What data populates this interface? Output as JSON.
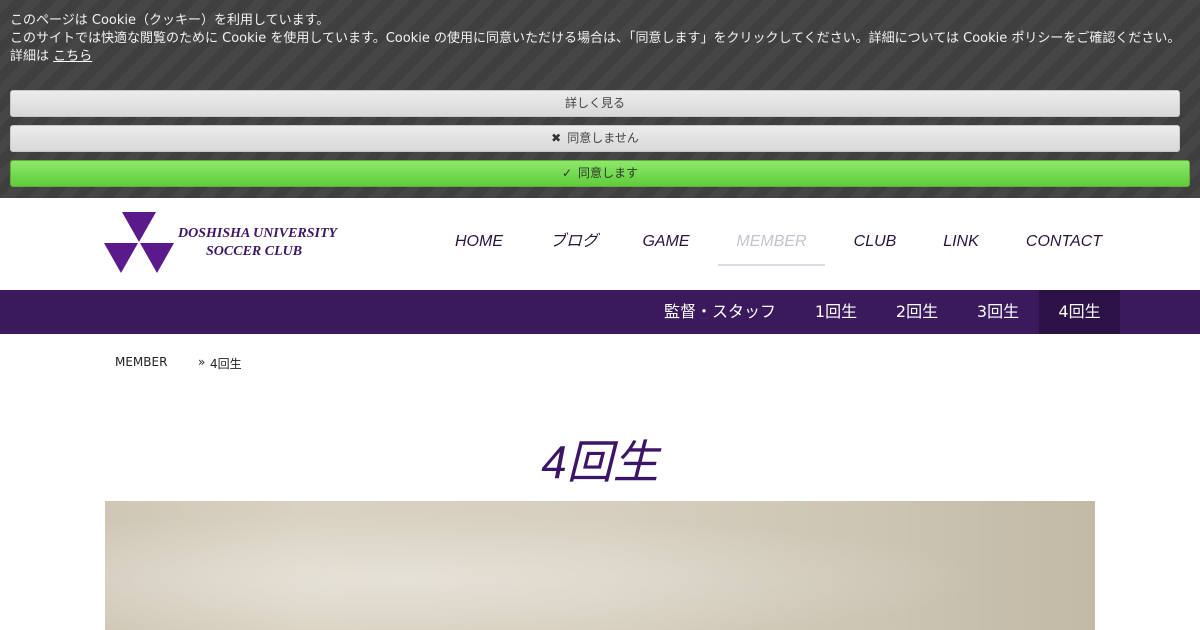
{
  "cookie": {
    "line1": "このページは Cookie（クッキー）を利用しています。",
    "line2": "このサイトでは快適な閲覧のために Cookie を使用しています。Cookie の使用に同意いただける場合は、「同意します」をクリックしてください。詳細については Cookie ポリシーをご確認ください。 詳細は",
    "link": "こちら",
    "details_label": "詳しく見る",
    "decline_label": "同意しません",
    "decline_icon": "✖",
    "accept_label": "同意します",
    "accept_icon": "✓"
  },
  "logo": {
    "line1": "DOSHISHA UNIVERSITY",
    "line2": "SOCCER CLUB",
    "color": "#5b1a8b"
  },
  "nav": {
    "items": [
      {
        "label": "HOME"
      },
      {
        "label": "ブログ"
      },
      {
        "label": "GAME"
      },
      {
        "label": "MEMBER",
        "active": true
      },
      {
        "label": "CLUB"
      },
      {
        "label": "LINK"
      },
      {
        "label": "CONTACT"
      }
    ]
  },
  "subnav": {
    "items": [
      {
        "label": "監督・スタッフ"
      },
      {
        "label": "1回生"
      },
      {
        "label": "2回生"
      },
      {
        "label": "3回生"
      },
      {
        "label": "4回生",
        "active": true
      }
    ]
  },
  "breadcrumb": {
    "parent": "MEMBER",
    "separator": "»",
    "current": "4回生"
  },
  "page": {
    "title": "4回生"
  },
  "colors": {
    "brand_purple": "#3a1a5c",
    "accept_green": "#6bd648"
  }
}
